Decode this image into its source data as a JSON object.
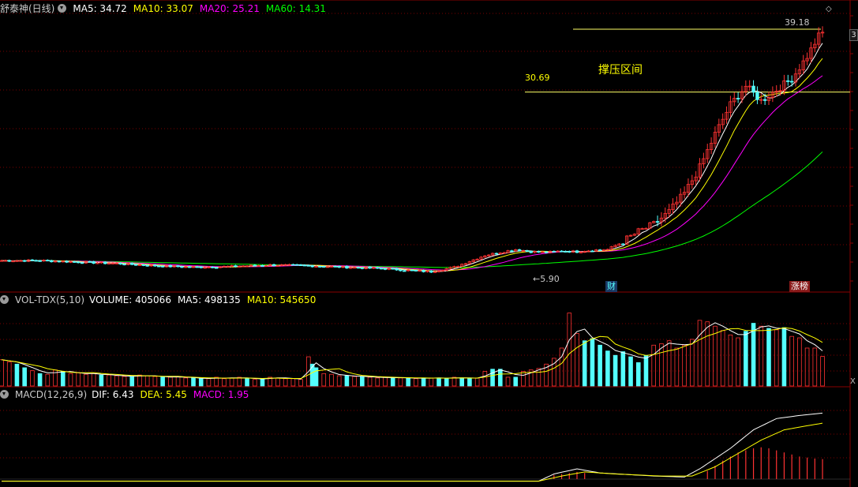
{
  "main_panel": {
    "stock_name": "舒泰神(日线)",
    "ma5_label": "MA5: 34.72",
    "ma10_label": "MA10: 33.07",
    "ma20_label": "MA20: 25.21",
    "ma60_label": "MA60: 14.31",
    "high_price": "39.18",
    "resist_price": "30.69",
    "resist_label": "撑压区间",
    "low_price": "5.90",
    "flag_finance": "财",
    "flag_limitup": "涨榜",
    "right_tab": "3"
  },
  "volume_panel": {
    "indicator": "VOL-TDX(5,10)",
    "volume_label": "VOLUME: 405066",
    "ma5_label": "MA5: 498135",
    "ma10_label": "MA10: 545650",
    "close_icon": "X"
  },
  "macd_panel": {
    "indicator": "MACD(12,26,9)",
    "dif_label": "DIF: 6.43",
    "dea_label": "DEA: 5.45",
    "macd_label": "MACD: 1.95"
  },
  "colors": {
    "up": "#ff3232",
    "down": "#54ffff",
    "ma5": "#ffffff",
    "ma10": "#ffff00",
    "ma20": "#ff00ff",
    "ma60": "#00ff00",
    "grid": "#7a0000"
  },
  "chart_data": {
    "type": "candlestick",
    "price_range": [
      4.5,
      41
    ],
    "reference_levels": [
      {
        "label": "39.18",
        "value": 39.18
      },
      {
        "label": "30.69",
        "value": 30.69
      }
    ],
    "last_values": {
      "MA5": 34.72,
      "MA10": 33.07,
      "MA20": 25.21,
      "MA60": 14.31,
      "VOLUME": 405066,
      "VOL_MA5": 498135,
      "VOL_MA10": 545650,
      "DIF": 6.43,
      "DEA": 5.45,
      "MACD": 1.95
    },
    "price_path": [
      [
        0,
        7.9
      ],
      [
        10,
        7.9
      ],
      [
        20,
        7.7
      ],
      [
        30,
        7.5
      ],
      [
        40,
        7.2
      ],
      [
        50,
        7.0
      ],
      [
        60,
        7.1
      ],
      [
        70,
        7.3
      ],
      [
        80,
        7.2
      ],
      [
        90,
        7.0
      ],
      [
        100,
        6.8
      ],
      [
        108,
        6.5
      ],
      [
        112,
        6.4
      ],
      [
        118,
        7.0
      ],
      [
        122,
        7.8
      ],
      [
        126,
        8.6
      ],
      [
        130,
        9.0
      ],
      [
        134,
        9.4
      ],
      [
        138,
        9.1
      ],
      [
        142,
        9.0
      ],
      [
        146,
        9.2
      ],
      [
        150,
        9.1
      ],
      [
        154,
        9.3
      ],
      [
        158,
        9.4
      ],
      [
        162,
        10.5
      ],
      [
        166,
        11.8
      ],
      [
        170,
        12.8
      ],
      [
        174,
        14.5
      ],
      [
        178,
        17.0
      ],
      [
        182,
        20.5
      ],
      [
        186,
        25.0
      ],
      [
        190,
        29.0
      ],
      [
        194,
        31.5
      ],
      [
        198,
        29.5
      ],
      [
        202,
        31.0
      ],
      [
        206,
        32.5
      ],
      [
        210,
        35.5
      ],
      [
        214,
        39.18
      ]
    ],
    "volume_bars": [
      [
        0,
        360000,
        1
      ],
      [
        2,
        330000,
        1
      ],
      [
        4,
        300000,
        0
      ],
      [
        6,
        250000,
        0
      ],
      [
        8,
        210000,
        1
      ],
      [
        10,
        170000,
        0
      ],
      [
        12,
        160000,
        1
      ],
      [
        14,
        220000,
        1
      ],
      [
        16,
        200000,
        0
      ],
      [
        18,
        170000,
        1
      ],
      [
        20,
        180000,
        1
      ],
      [
        22,
        160000,
        1
      ],
      [
        24,
        170000,
        1
      ],
      [
        26,
        150000,
        0
      ],
      [
        28,
        150000,
        1
      ],
      [
        30,
        140000,
        1
      ],
      [
        32,
        130000,
        1
      ],
      [
        34,
        130000,
        0
      ],
      [
        36,
        150000,
        1
      ],
      [
        38,
        140000,
        1
      ],
      [
        40,
        130000,
        1
      ],
      [
        42,
        120000,
        0
      ],
      [
        44,
        120000,
        1
      ],
      [
        46,
        130000,
        1
      ],
      [
        48,
        110000,
        1
      ],
      [
        50,
        110000,
        0
      ],
      [
        52,
        100000,
        0
      ],
      [
        54,
        100000,
        1
      ],
      [
        56,
        120000,
        1
      ],
      [
        58,
        100000,
        1
      ],
      [
        60,
        110000,
        1
      ],
      [
        62,
        120000,
        1
      ],
      [
        64,
        100000,
        0
      ],
      [
        66,
        90000,
        1
      ],
      [
        68,
        100000,
        0
      ],
      [
        70,
        120000,
        1
      ],
      [
        72,
        110000,
        1
      ],
      [
        74,
        100000,
        1
      ],
      [
        76,
        100000,
        1
      ],
      [
        78,
        90000,
        1
      ],
      [
        80,
        400000,
        1
      ],
      [
        81,
        300000,
        0
      ],
      [
        82,
        250000,
        0
      ],
      [
        84,
        170000,
        1
      ],
      [
        86,
        160000,
        1
      ],
      [
        88,
        140000,
        1
      ],
      [
        90,
        140000,
        0
      ],
      [
        92,
        130000,
        1
      ],
      [
        94,
        130000,
        0
      ],
      [
        96,
        120000,
        1
      ],
      [
        98,
        110000,
        1
      ],
      [
        100,
        120000,
        1
      ],
      [
        102,
        110000,
        0
      ],
      [
        104,
        110000,
        1
      ],
      [
        106,
        110000,
        0
      ],
      [
        108,
        100000,
        1
      ],
      [
        110,
        110000,
        0
      ],
      [
        112,
        110000,
        1
      ],
      [
        114,
        110000,
        0
      ],
      [
        116,
        100000,
        0
      ],
      [
        118,
        120000,
        1
      ],
      [
        120,
        110000,
        0
      ],
      [
        122,
        100000,
        0
      ],
      [
        124,
        110000,
        1
      ],
      [
        126,
        200000,
        1
      ],
      [
        128,
        230000,
        0
      ],
      [
        130,
        230000,
        0
      ],
      [
        132,
        120000,
        1
      ],
      [
        134,
        120000,
        0
      ],
      [
        136,
        200000,
        1
      ],
      [
        138,
        220000,
        1
      ],
      [
        140,
        240000,
        1
      ],
      [
        142,
        300000,
        1
      ],
      [
        144,
        380000,
        1
      ],
      [
        146,
        520000,
        1
      ],
      [
        148,
        1000000,
        1
      ],
      [
        150,
        720000,
        1
      ],
      [
        152,
        620000,
        0
      ],
      [
        154,
        650000,
        0
      ],
      [
        156,
        560000,
        0
      ],
      [
        158,
        480000,
        0
      ],
      [
        160,
        420000,
        0
      ],
      [
        162,
        470000,
        0
      ],
      [
        164,
        400000,
        0
      ],
      [
        166,
        320000,
        0
      ],
      [
        168,
        420000,
        0
      ],
      [
        170,
        560000,
        1
      ],
      [
        172,
        580000,
        1
      ],
      [
        174,
        620000,
        1
      ],
      [
        176,
        520000,
        1
      ],
      [
        178,
        560000,
        1
      ],
      [
        180,
        640000,
        1
      ],
      [
        182,
        900000,
        1
      ],
      [
        184,
        880000,
        1
      ],
      [
        186,
        820000,
        1
      ],
      [
        188,
        760000,
        1
      ],
      [
        190,
        700000,
        1
      ],
      [
        192,
        660000,
        1
      ],
      [
        194,
        750000,
        0
      ],
      [
        196,
        860000,
        0
      ],
      [
        198,
        820000,
        1
      ],
      [
        200,
        790000,
        0
      ],
      [
        202,
        770000,
        1
      ],
      [
        204,
        800000,
        0
      ],
      [
        206,
        680000,
        1
      ],
      [
        208,
        660000,
        1
      ],
      [
        210,
        520000,
        1
      ],
      [
        212,
        520000,
        1
      ],
      [
        214,
        405066,
        1
      ]
    ],
    "macd_path": {
      "DIF": [
        [
          0,
          -0.2
        ],
        [
          140,
          -0.2
        ],
        [
          144,
          0.5
        ],
        [
          150,
          1.0
        ],
        [
          156,
          0.6
        ],
        [
          170,
          0.3
        ],
        [
          178,
          0.2
        ],
        [
          182,
          1.0
        ],
        [
          190,
          3.0
        ],
        [
          196,
          4.8
        ],
        [
          202,
          5.9
        ],
        [
          208,
          6.2
        ],
        [
          214,
          6.43
        ]
      ],
      "DEA": [
        [
          0,
          -0.2
        ],
        [
          140,
          -0.2
        ],
        [
          146,
          0.3
        ],
        [
          152,
          0.7
        ],
        [
          160,
          0.5
        ],
        [
          172,
          0.3
        ],
        [
          180,
          0.3
        ],
        [
          186,
          1.2
        ],
        [
          192,
          2.5
        ],
        [
          198,
          3.8
        ],
        [
          204,
          4.8
        ],
        [
          210,
          5.2
        ],
        [
          214,
          5.45
        ]
      ],
      "MACD_bars": [
        [
          144,
          0.4
        ],
        [
          146,
          0.5
        ],
        [
          148,
          0.6
        ],
        [
          150,
          0.7
        ],
        [
          152,
          0.6
        ],
        [
          184,
          0.8
        ],
        [
          186,
          1.3
        ],
        [
          188,
          1.8
        ],
        [
          190,
          2.2
        ],
        [
          192,
          2.6
        ],
        [
          194,
          2.8
        ],
        [
          196,
          3.0
        ],
        [
          198,
          3.1
        ],
        [
          200,
          3.0
        ],
        [
          202,
          2.8
        ],
        [
          204,
          2.6
        ],
        [
          206,
          2.4
        ],
        [
          208,
          2.2
        ],
        [
          210,
          2.1
        ],
        [
          212,
          2.0
        ],
        [
          214,
          1.95
        ]
      ]
    }
  }
}
